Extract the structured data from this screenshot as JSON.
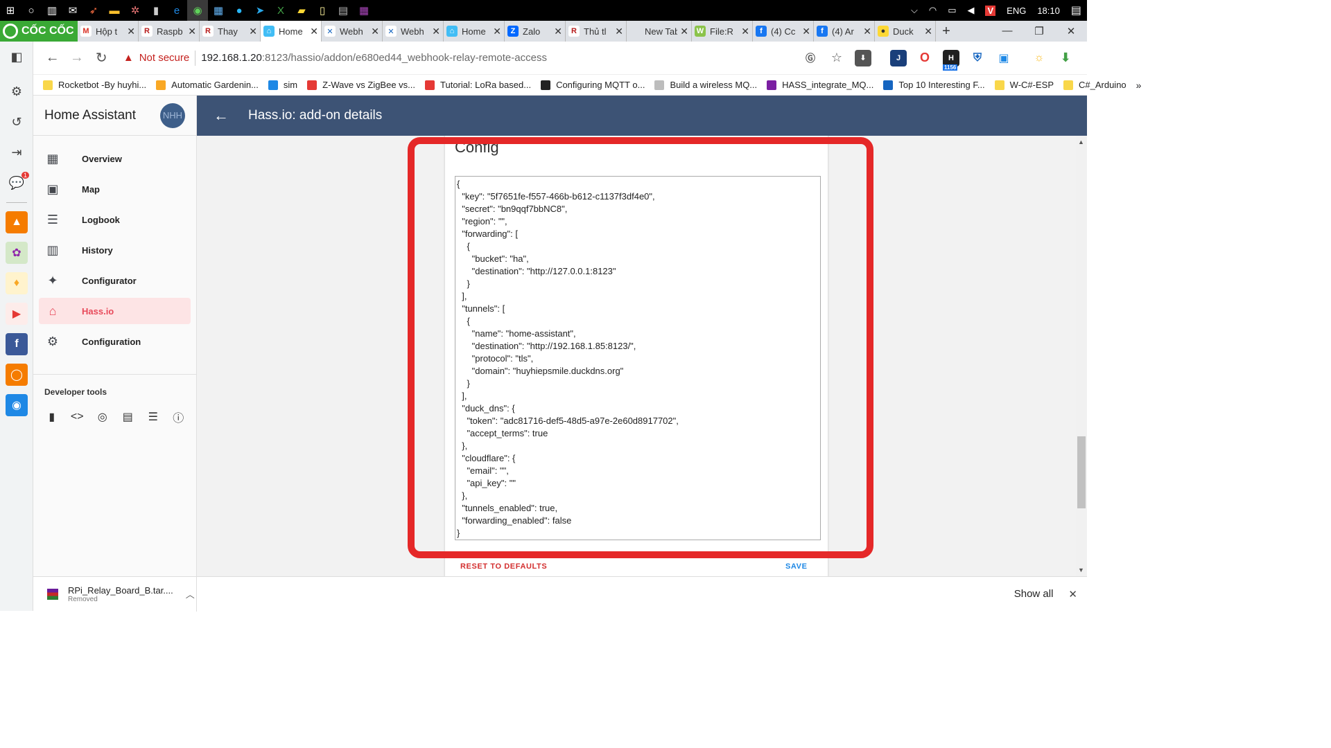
{
  "taskbar": {
    "language": "ENG",
    "time": "18:10"
  },
  "tabs": [
    {
      "label": "Hộp t",
      "fav": "M",
      "color": "#ffffff",
      "fg": "#d93025"
    },
    {
      "label": "Raspb",
      "fav": "R",
      "color": "#ffffff",
      "fg": "#b71c1c"
    },
    {
      "label": "Thay",
      "fav": "R",
      "color": "#ffffff",
      "fg": "#b71c1c"
    },
    {
      "label": "Home",
      "fav": "⌂",
      "color": "#41bdf5",
      "fg": "#ffffff",
      "active": true
    },
    {
      "label": "Webh",
      "fav": "✕",
      "color": "#ffffff",
      "fg": "#1565c0"
    },
    {
      "label": "Webh",
      "fav": "✕",
      "color": "#ffffff",
      "fg": "#1565c0"
    },
    {
      "label": "Home",
      "fav": "⌂",
      "color": "#41bdf5",
      "fg": "#ffffff"
    },
    {
      "label": "Zalo",
      "fav": "Z",
      "color": "#0068ff",
      "fg": "#ffffff"
    },
    {
      "label": "Thủ tl",
      "fav": "R",
      "color": "#ffffff",
      "fg": "#b71c1c"
    },
    {
      "label": "New Tab",
      "fav": "",
      "color": "transparent",
      "fg": "#333"
    },
    {
      "label": "File:R",
      "fav": "W",
      "color": "#8bc34a",
      "fg": "#ffffff"
    },
    {
      "label": "(4) Cc",
      "fav": "f",
      "color": "#1877f2",
      "fg": "#ffffff"
    },
    {
      "label": "(4) Ar",
      "fav": "f",
      "color": "#1877f2",
      "fg": "#ffffff"
    },
    {
      "label": "Duck",
      "fav": "●",
      "color": "#fdd835",
      "fg": "#333333"
    }
  ],
  "browser": {
    "brand": "CỐC CỐC",
    "not_secure": "Not secure",
    "url_host": "192.168.1.20",
    "url_rest": ":8123/hassio/addon/e680ed44_webhook-relay-remote-access",
    "ext_badge": "1156"
  },
  "bookmarks": [
    {
      "label": "Rocketbot -By huyhi...",
      "color": "#f9d74a"
    },
    {
      "label": "Automatic Gardenin...",
      "color": "#f9a825"
    },
    {
      "label": "sim",
      "color": "#1e88e5"
    },
    {
      "label": "Z-Wave vs ZigBee vs...",
      "color": "#e53935"
    },
    {
      "label": "Tutorial: LoRa based...",
      "color": "#e53935"
    },
    {
      "label": "Configuring MQTT o...",
      "color": "#212121"
    },
    {
      "label": "Build a wireless MQ...",
      "color": "#bdbdbd"
    },
    {
      "label": "HASS_integrate_MQ...",
      "color": "#7b1fa2"
    },
    {
      "label": "Top 10 Interesting F...",
      "color": "#1565c0"
    },
    {
      "label": "W-C#-ESP",
      "color": "#f9d74a"
    },
    {
      "label": "C#_Arduino",
      "color": "#f9d74a"
    }
  ],
  "ha": {
    "title": "Home Assistant",
    "avatar": "NHH",
    "page_title": "Hass.io: add-on details",
    "nav": [
      {
        "label": "Overview",
        "icon": "grid-icon"
      },
      {
        "label": "Map",
        "icon": "map-person-icon"
      },
      {
        "label": "Logbook",
        "icon": "list-icon"
      },
      {
        "label": "History",
        "icon": "chart-icon"
      },
      {
        "label": "Configurator",
        "icon": "puzzle-icon"
      },
      {
        "label": "Hass.io",
        "icon": "hassio-icon",
        "active": true
      },
      {
        "label": "Configuration",
        "icon": "gear-icon"
      }
    ],
    "dev_tools_label": "Developer tools"
  },
  "config": {
    "title": "Config",
    "text": "{\n  \"key\": \"5f7651fe-f557-466b-b612-c1137f3df4e0\",\n  \"secret\": \"bn9qqf7bbNC8\",\n  \"region\": \"\",\n  \"forwarding\": [\n    {\n      \"bucket\": \"ha\",\n      \"destination\": \"http://127.0.0.1:8123\"\n    }\n  ],\n  \"tunnels\": [\n    {\n      \"name\": \"home-assistant\",\n      \"destination\": \"http://192.168.1.85:8123/\",\n      \"protocol\": \"tls\",\n      \"domain\": \"huyhiepsmile.duckdns.org\"\n    }\n  ],\n  \"duck_dns\": {\n    \"token\": \"adc81716-def5-48d5-a97e-2e60d8917702\",\n    \"accept_terms\": true\n  },\n  \"cloudflare\": {\n    \"email\": \"\",\n    \"api_key\": \"\"\n  },\n  \"tunnels_enabled\": true,\n  \"forwarding_enabled\": false\n}",
    "reset_label": "RESET TO DEFAULTS",
    "save_label": "SAVE"
  },
  "download": {
    "filename": "RPi_Relay_Board_B.tar....",
    "status": "Removed",
    "show_all": "Show all"
  },
  "colors": {
    "header": "#3d5375",
    "highlight": "#e52828",
    "active_nav": "#e8495a"
  }
}
